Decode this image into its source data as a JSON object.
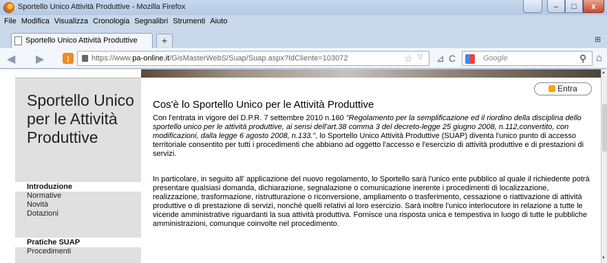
{
  "window": {
    "title": "Sportello Unico Attività Produttive - Mozilla Firefox",
    "close_glyph": "x"
  },
  "menu": [
    "File",
    "Modifica",
    "Visualizza",
    "Cronologia",
    "Segnalibri",
    "Strumenti",
    "Aiuto"
  ],
  "tabs": {
    "active_label": "Sportello Unico Attività Produttive",
    "new_tab_glyph": "+"
  },
  "navbar": {
    "url_prefix": "https://www.",
    "url_domain": "pa-online.it",
    "url_path": "/GisMasterWebS/Suap/Suap.aspx?IdCliente=103072",
    "search_placeholder": "Google"
  },
  "sidebar": {
    "title": "Sportello Unico per le Attività Produttive",
    "section1": {
      "head": "Introduzione",
      "items": [
        "Normative",
        "Novità",
        "Dotazioni"
      ]
    },
    "section2": {
      "head": "Pratiche SUAP",
      "items": [
        "Procedimenti"
      ]
    }
  },
  "main": {
    "enter_button": "Entra",
    "heading": "Cos'è lo Sportello Unico per le Attività Produttive",
    "p1_start": "Con l'entrata in vigore del D.P.R. 7 settembre 2010 n.160 ",
    "p1_italic": "\"Regolamento per la semplificazione ed il riordino della disciplina dello sportello unico per le attività produttive, ai sensi dell'art.38 comma 3 del decreto-legge 25 giugno 2008, n.112,convertito, con modificazioni, dalla legge 6 agosto 2008, n.133.\"",
    "p1_end": ", lo Sportello Unico Attività Produttive (SUAP) diventa l'unico punto di accesso territoriale consentito per tutti i procedimenti che abbiano ad oggetto l'accesso e l'esercizio di attività produttive e di prestazioni di servizi.",
    "p2": "In particolare, in seguito all' applicazione del nuovo regolamento, lo Sportello sarà l'unico ente pubblico al quale il richiedente potrà presentare qualsiasi domanda, dichiarazione, segnalazione o comunicazione inerente i procedimenti di localizzazione, realizzazione, trasformazione, ristrutturazione o riconversione, ampliamento o trasferimento, cessazione o riattivazione di attività produttive o di prestazione di servizi, nonché quelli relativi al loro esercizio. Sarà inoltre l'unico interlocutore in relazione a tutte le vicende amministrative riguardanti la sua attività produttiva. Fornisce una risposta unica e tempestiva in luogo di tutte le pubbliche amministrazioni, comunque coinvolte nel procedimento."
  }
}
